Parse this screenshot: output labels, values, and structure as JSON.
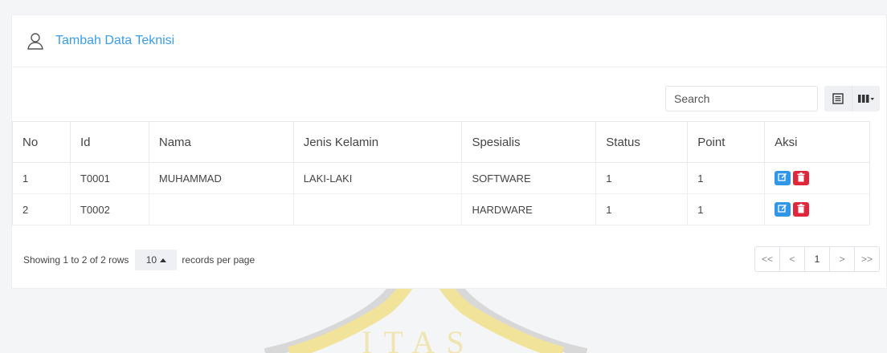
{
  "header": {
    "title": "Tambah Data Teknisi",
    "icon": "user-icon"
  },
  "toolbar": {
    "search_placeholder": "Search",
    "toggle_icon": "list-icon",
    "columns_icon": "columns-icon"
  },
  "table": {
    "columns": [
      "No",
      "Id",
      "Nama",
      "Jenis Kelamin",
      "Spesialis",
      "Status",
      "Point",
      "Aksi"
    ],
    "rows": [
      [
        "1",
        "T0001",
        "MUHAMMAD",
        "LAKI-LAKI",
        "SOFTWARE",
        "1",
        "1"
      ],
      [
        "2",
        "T0002",
        "",
        "",
        "HARDWARE",
        "1",
        "1"
      ]
    ]
  },
  "footer": {
    "showing": "Showing 1 to 2 of 2 rows",
    "page_size": "10",
    "per_page": "records per page",
    "pages": [
      "<<",
      "<",
      "1",
      ">",
      ">>"
    ]
  },
  "colors": {
    "accent": "#3a9ee8",
    "edit": "#2f96e8",
    "delete": "#e0263a",
    "watermark": "#f0e3a0"
  }
}
